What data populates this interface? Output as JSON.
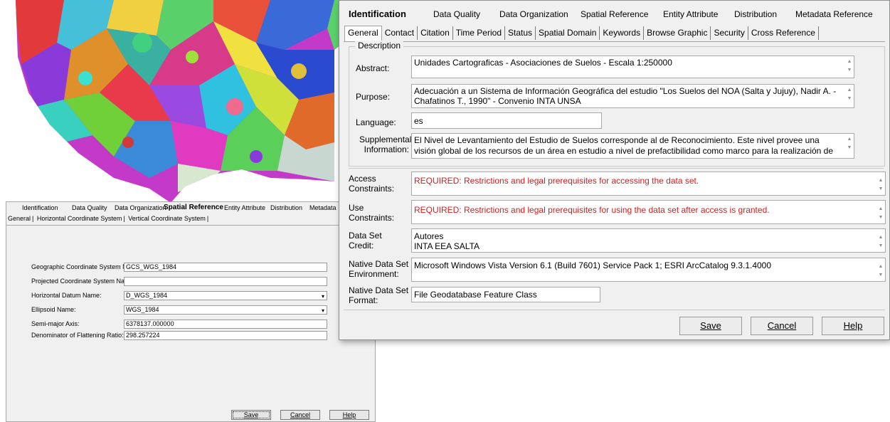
{
  "back_dialog": {
    "nav": [
      "Identification",
      "Data Quality",
      "Data Organization",
      "Spatial Reference",
      "Entity Attribute",
      "Distribution",
      "Metadata"
    ],
    "tabs": [
      "General",
      "Horizontal Coordinate System",
      "Vertical Coordinate System"
    ],
    "fields": [
      {
        "label": "Geographic Coordinate System Name:",
        "value": "GCS_WGS_1984",
        "dropdown": false
      },
      {
        "label": "Projected Coordinate System Name:",
        "value": "",
        "dropdown": false
      },
      {
        "label": "Horizontal Datum Name:",
        "value": "D_WGS_1984",
        "dropdown": true
      },
      {
        "label": "Ellipsoid Name:",
        "value": "WGS_1984",
        "dropdown": true
      },
      {
        "label": "Semi-major Axis:",
        "value": "6378137.000000",
        "dropdown": false
      },
      {
        "label": "Denominator of Flattening Ratio:",
        "value": "298.257224",
        "dropdown": false
      }
    ],
    "buttons": {
      "save": "Save",
      "cancel": "Cancel",
      "help": "Help"
    }
  },
  "front_dialog": {
    "nav": [
      "Identification",
      "Data Quality",
      "Data Organization",
      "Spatial Reference",
      "Entity Attribute",
      "Distribution",
      "Metadata Reference"
    ],
    "tabs": [
      "General",
      "Contact",
      "Citation",
      "Time Period",
      "Status",
      "Spatial Domain",
      "Keywords",
      "Browse Graphic",
      "Security",
      "Cross Reference"
    ],
    "description_group": "Description",
    "abstract": {
      "label": "Abstract:",
      "value": "Unidades Cartograficas - Asociaciones de Suelos - Escala 1:250000"
    },
    "purpose": {
      "label": "Purpose:",
      "value": "Adecuación a un Sistema de Información Geográfica del estudio \"Los Suelos del NOA (Salta y Jujuy), Nadir A. - Chafatinos T., 1990\" - Convenio INTA UNSA"
    },
    "language": {
      "label": "Language:",
      "value": "es"
    },
    "supplemental": {
      "label": "Supplemental Information:",
      "value": "El Nivel de Levantamiento del Estudio de Suelos corresponde al de Reconocimiento. Este nivel provee una visión global de los recursos de un área en estudio a nivel de prefactibilidad como marco para la realización de levantamientos"
    },
    "access": {
      "label": "Access Constraints:",
      "value": "REQUIRED: Restrictions and legal prerequisites for accessing the data set."
    },
    "use": {
      "label": "Use Constraints:",
      "value": "REQUIRED: Restrictions and legal prerequisites for using the data set after access is granted."
    },
    "credit": {
      "label": "Data Set Credit:",
      "line1": "Autores",
      "line2": "INTA EEA SALTA"
    },
    "environment": {
      "label": "Native Data Set Environment:",
      "value": "Microsoft Windows Vista Version 6.1 (Build 7601) Service Pack 1; ESRI ArcCatalog 9.3.1.4000"
    },
    "format": {
      "label": "Native Data Set Format:",
      "value": "File Geodatabase Feature Class"
    },
    "buttons": {
      "save": "Save",
      "cancel": "Cancel",
      "help": "Help"
    },
    "required_color": "#d02020"
  }
}
